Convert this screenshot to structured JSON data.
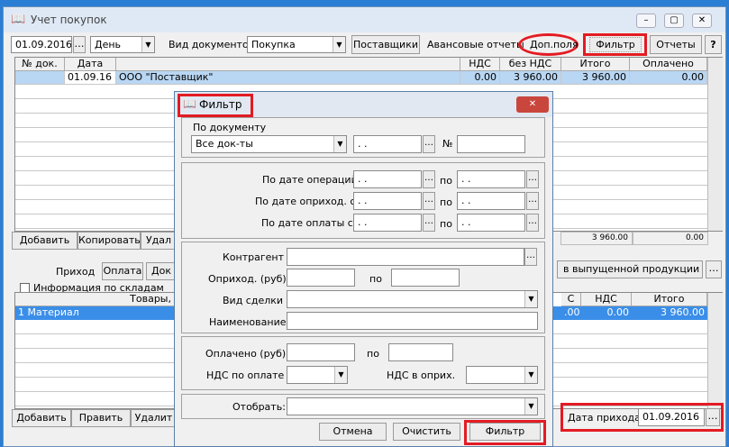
{
  "window": {
    "title": "Учет покупок",
    "icon": "book-icon",
    "help": "?"
  },
  "toolbar": {
    "date": "01.09.2016",
    "period": "День",
    "doc_type_label": "Вид документов",
    "doc_type": "Покупка",
    "tabs": [
      "Поставщики",
      "Авансовые отчеты",
      "Доп.поля",
      "Фильтр",
      "Отчеты"
    ]
  },
  "top_grid": {
    "columns": [
      "№ док.",
      "Дата",
      "",
      "НДС",
      "без НДС",
      "Итого",
      "Оплачено"
    ],
    "rows": [
      [
        "",
        "01.09.16",
        "ООО \"Поставщик\"",
        "0.00",
        "3 960.00",
        "3 960.00",
        "0.00"
      ]
    ],
    "totals": {
      "itogo": "3 960.00",
      "oplacheno": "0.00"
    }
  },
  "top_buttons": [
    "Добавить",
    "Копировать",
    "Удал"
  ],
  "lower": {
    "tabs": [
      "Приход",
      "Оплата",
      "Док"
    ],
    "checkbox_label": "Информация по складам",
    "col_goods": "Товары,",
    "right_tab": "в выпущенной продукции (прямы",
    "right_cols": [
      "С",
      "НДС",
      "Итого"
    ],
    "row_left": "1 Материал",
    "row_right": [
      ".00",
      "0.00",
      "3 960.00"
    ],
    "buttons": [
      "Добавить",
      "Править",
      "Удалит"
    ],
    "date_label": "Дата прихода",
    "date_value": "01.09.2016"
  },
  "dialog": {
    "title": "Фильтр",
    "icon": "book-icon",
    "close": "✕",
    "by_document": "По документу",
    "doc_select": "Все док-ты",
    "date_placeholder": ". .",
    "number_label": "№",
    "ops_from": "По дате операций с",
    "arrival_from": "По дате оприход. с",
    "pay_from": "По дате оплаты с",
    "to": "по",
    "counterparty": "Контрагент",
    "posted_from": "Оприход. (руб) с",
    "deal_type": "Вид сделки",
    "name": "Наименование",
    "paid_from": "Оплачено (руб) с",
    "vat_pay": "НДС по оплате",
    "vat_posted": "НДС в оприх.",
    "select": "Отобрать:",
    "buttons": {
      "cancel": "Отмена",
      "clear": "Очистить",
      "filter": "Фильтр"
    }
  }
}
